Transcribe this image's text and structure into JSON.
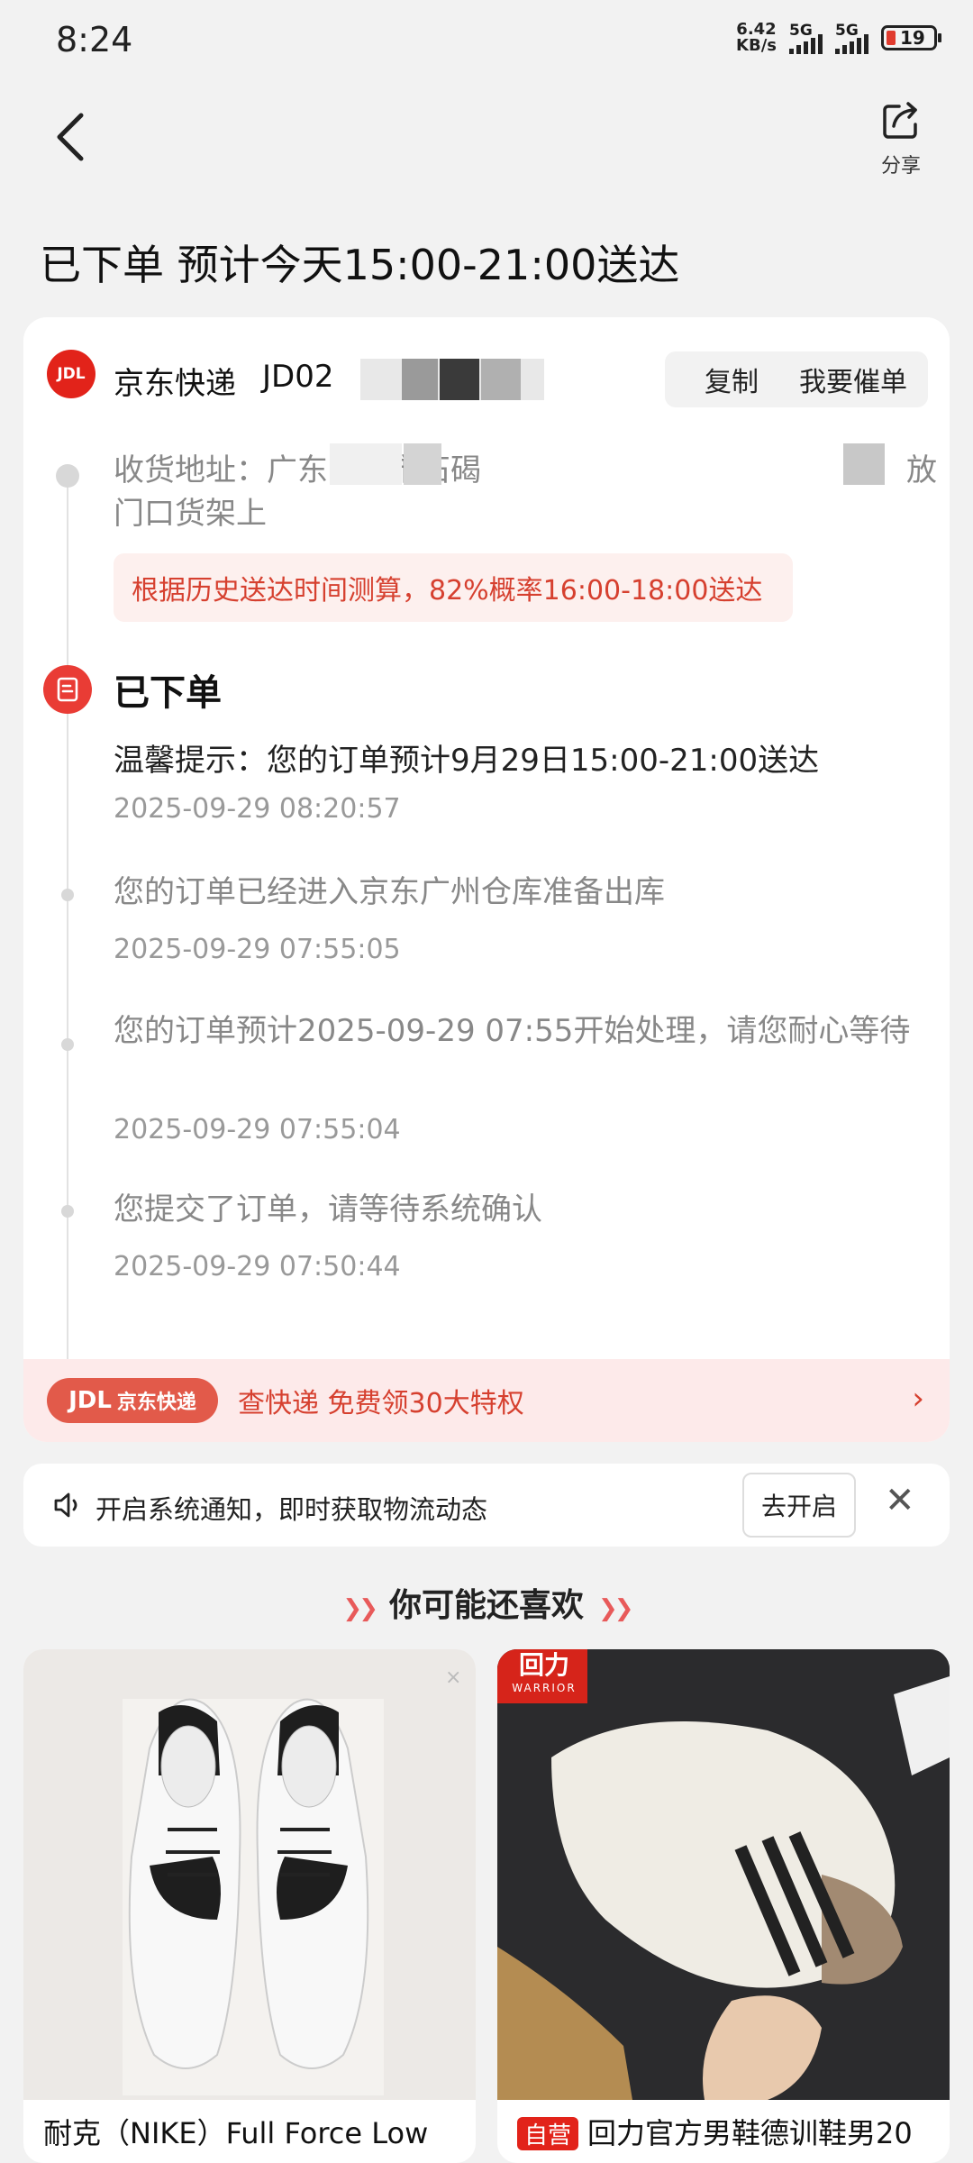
{
  "status_bar": {
    "time": "8:24",
    "net_speed_value": "6.42",
    "net_speed_unit": "KB/s",
    "sig1": "5G",
    "sig2": "5G",
    "battery": "19"
  },
  "header": {
    "share_label": "分享"
  },
  "title": "已下单 预计今天15:00-21:00送达",
  "courier": {
    "logo_text": "JDL",
    "name": "京东快递",
    "tracking_prefix": "JD02",
    "copy_label": "复制",
    "urge_label": "我要催单"
  },
  "address": {
    "line": "收货地址：广东东莞市石碣",
    "tail": "放",
    "line2": "门口货架上"
  },
  "estimate_tip": "根据历史送达时间测算，82%概率16:00-18:00送达",
  "current": {
    "status": "已下单",
    "tip": "温馨提示：您的订单预计9月29日15:00-21:00送达",
    "time": "2025-09-29 08:20:57"
  },
  "events": [
    {
      "text": "您的订单已经进入京东广州仓库准备出库",
      "time": "2025-09-29 07:55:05"
    },
    {
      "text": "您的订单预计2025-09-29 07:55开始处理，请您耐心等待",
      "time": "2025-09-29 07:55:04"
    },
    {
      "text": "您提交了订单，请等待系统确认",
      "time": "2025-09-29 07:50:44"
    }
  ],
  "promo": {
    "pill_logo": "JDL",
    "pill_text": "京东快递",
    "text": "查快递 免费领30大特权",
    "arrow": "›"
  },
  "notify": {
    "text": "开启系统通知，即时获取物流动态",
    "button": "去开启",
    "close": "✕"
  },
  "recommend": {
    "title": "你可能还喜欢"
  },
  "products": [
    {
      "title": "耐克（NIKE）Full Force Low",
      "badge": ""
    },
    {
      "title": "回力官方男鞋德训鞋男20",
      "badge": "自营",
      "brand": "回力",
      "brand_sub": "WARRIOR"
    }
  ],
  "colors": {
    "brand_red": "#e2231a",
    "tip_red": "#d6402f",
    "tip_bg": "#fdf0ee"
  }
}
